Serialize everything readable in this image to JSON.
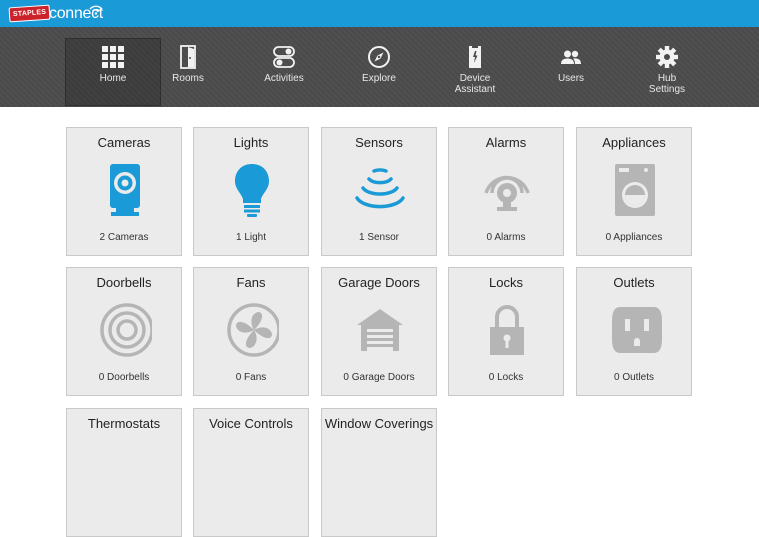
{
  "brand": {
    "badge": "STAPLES",
    "name": "connect"
  },
  "nav": [
    {
      "id": "home",
      "label": "Home",
      "icon": "grid-icon",
      "active": true
    },
    {
      "id": "rooms",
      "label": "Rooms",
      "icon": "door-icon"
    },
    {
      "id": "activities",
      "label": "Activities",
      "icon": "toggle-icon"
    },
    {
      "id": "explore",
      "label": "Explore",
      "icon": "compass-icon"
    },
    {
      "id": "device-assistant",
      "label": "Device Assistant",
      "icon": "device-assistant-icon"
    },
    {
      "id": "users",
      "label": "Users",
      "icon": "users-icon"
    },
    {
      "id": "hub-settings",
      "label": "Hub Settings",
      "icon": "gear-icon"
    }
  ],
  "tiles": [
    {
      "id": "cameras",
      "title": "Cameras",
      "count": "2 Cameras",
      "icon": "camera-icon",
      "active": true
    },
    {
      "id": "lights",
      "title": "Lights",
      "count": "1 Light",
      "icon": "bulb-icon",
      "active": true
    },
    {
      "id": "sensors",
      "title": "Sensors",
      "count": "1 Sensor",
      "icon": "sensor-icon",
      "active": true
    },
    {
      "id": "alarms",
      "title": "Alarms",
      "count": "0 Alarms",
      "icon": "alarm-icon"
    },
    {
      "id": "appliances",
      "title": "Appliances",
      "count": "0 Appliances",
      "icon": "washer-icon"
    },
    {
      "id": "doorbells",
      "title": "Doorbells",
      "count": "0 Doorbells",
      "icon": "doorbell-icon"
    },
    {
      "id": "fans",
      "title": "Fans",
      "count": "0 Fans",
      "icon": "fan-icon"
    },
    {
      "id": "garage-doors",
      "title": "Garage Doors",
      "count": "0 Garage Doors",
      "icon": "garage-icon"
    },
    {
      "id": "locks",
      "title": "Locks",
      "count": "0 Locks",
      "icon": "lock-icon"
    },
    {
      "id": "outlets",
      "title": "Outlets",
      "count": "0 Outlets",
      "icon": "outlet-icon"
    },
    {
      "id": "thermostats",
      "title": "Thermostats",
      "count": "",
      "icon": "thermostat-icon"
    },
    {
      "id": "voice-controls",
      "title": "Voice Controls",
      "count": "",
      "icon": "microphone-icon"
    },
    {
      "id": "window-coverings",
      "title": "Window Coverings",
      "count": "",
      "icon": "blinds-icon"
    }
  ],
  "colors": {
    "accent": "#1a9ad7",
    "inactive_icon": "#b5b5b5",
    "nav_bg": "#4a4a4a",
    "brand_red": "#cc2229"
  }
}
